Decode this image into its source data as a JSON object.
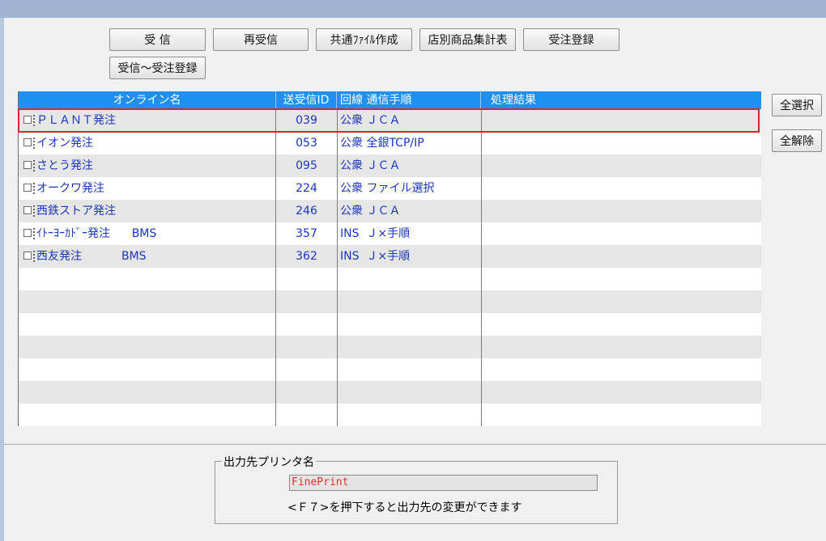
{
  "toolbar": {
    "receive": "受 信",
    "re_receive": "再受信",
    "create_common_file": "共通ﾌｧｲﾙ作成",
    "store_product_summary": "店別商品集計表",
    "order_registration": "受注登録",
    "receive_to_order": "受信～受注登録"
  },
  "side": {
    "select_all": "全選択",
    "deselect_all": "全解除"
  },
  "grid": {
    "headers": {
      "online_name": "オンライン名",
      "send_recv_id": "送受信ID",
      "line_protocol": "回線  通信手順",
      "result": "処理結果"
    },
    "rows": [
      {
        "name": "ＰＬＡＮＴ発注",
        "id": "039",
        "line": "公衆 ＪＣＡ",
        "result": ""
      },
      {
        "name": "イオン発注",
        "id": "053",
        "line": "公衆 全銀TCP/IP",
        "result": ""
      },
      {
        "name": "さとう発注",
        "id": "095",
        "line": "公衆 ＪＣＡ",
        "result": ""
      },
      {
        "name": "オークワ発注",
        "id": "224",
        "line": "公衆 ファイル選択",
        "result": ""
      },
      {
        "name": "西鉄ストア発注",
        "id": "246",
        "line": "公衆 ＪＣＡ",
        "result": ""
      },
      {
        "name": "ｲﾄｰﾖｰｶﾄﾞｰ発注      BMS",
        "id": "357",
        "line": "INS  Ｊ×手順",
        "result": ""
      },
      {
        "name": "西友発注           BMS",
        "id": "362",
        "line": "INS  Ｊ×手順",
        "result": ""
      }
    ]
  },
  "printer": {
    "group_label": "出力先プリンタ名",
    "value": "FinePrint",
    "hint": "<Ｆ７>を押下すると出力先の変更ができます"
  }
}
